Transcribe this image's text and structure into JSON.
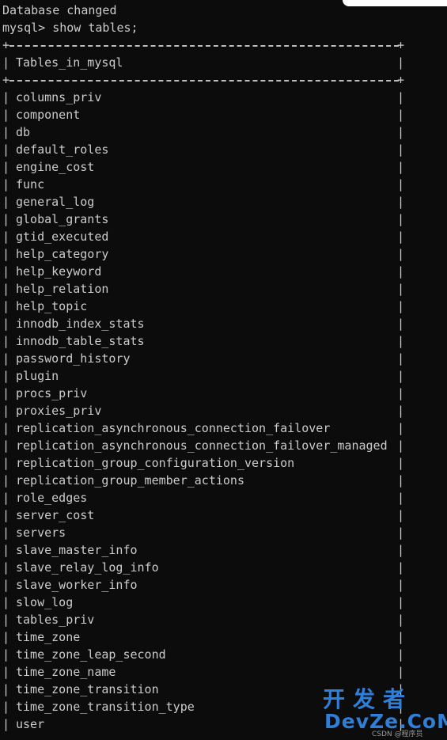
{
  "terminal": {
    "lines": [
      "Database changed",
      "mysql> show tables;"
    ],
    "table": {
      "header": "Tables_in_mysql",
      "rows": [
        "columns_priv",
        "component",
        "db",
        "default_roles",
        "engine_cost",
        "func",
        "general_log",
        "global_grants",
        "gtid_executed",
        "help_category",
        "help_keyword",
        "help_relation",
        "help_topic",
        "innodb_index_stats",
        "innodb_table_stats",
        "password_history",
        "plugin",
        "procs_priv",
        "proxies_priv",
        "replication_asynchronous_connection_failover",
        "replication_asynchronous_connection_failover_managed",
        "replication_group_configuration_version",
        "replication_group_member_actions",
        "role_edges",
        "server_cost",
        "servers",
        "slave_master_info",
        "slave_relay_log_info",
        "slave_worker_info",
        "slow_log",
        "tables_priv",
        "time_zone",
        "time_zone_leap_second",
        "time_zone_name",
        "time_zone_transition",
        "time_zone_transition_type",
        "user"
      ]
    },
    "border_glyphs": {
      "corner": "+",
      "side": "|"
    }
  },
  "watermark": {
    "chinese": "开发者",
    "brand": "DevZe.CoM",
    "small": "CSDN @程序员"
  },
  "colors": {
    "background": "#0c0c0c",
    "text": "#cccccc",
    "watermark": "#2f7fd8"
  }
}
